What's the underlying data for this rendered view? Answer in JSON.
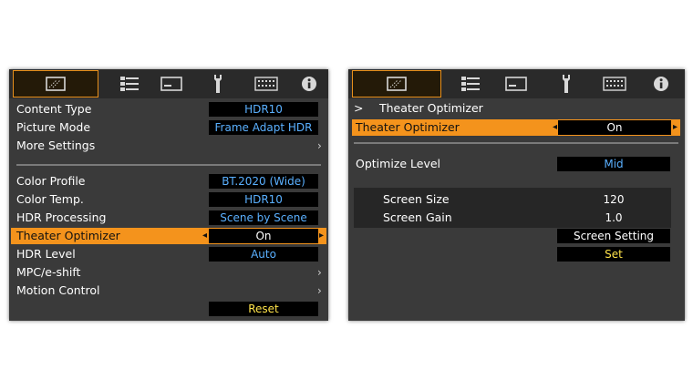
{
  "tabs": [
    "picture-icon",
    "settings-list-icon",
    "display-icon",
    "wrench-icon",
    "keyboard-icon",
    "info-icon"
  ],
  "left": {
    "rows": [
      {
        "label": "Content Type",
        "value": "HDR10"
      },
      {
        "label": "Picture Mode",
        "value": "Frame Adapt HDR"
      },
      {
        "label": "More Settings",
        "arrow": "›"
      },
      {
        "label": "Color Profile",
        "value": "BT.2020 (Wide)"
      },
      {
        "label": "Color Temp.",
        "value": "HDR10"
      },
      {
        "label": "HDR Processing",
        "value": "Scene by Scene"
      },
      {
        "label": "Theater Optimizer",
        "value": "On",
        "left_arrow": "◂",
        "right_arrow": "▸"
      },
      {
        "label": "HDR Level",
        "value": "Auto"
      },
      {
        "label": "MPC/e-shift",
        "arrow": "›"
      },
      {
        "label": "Motion Control",
        "arrow": "›"
      }
    ],
    "reset_label": "Reset"
  },
  "right": {
    "breadcrumb_arrow": ">",
    "breadcrumb": "Theater Optimizer",
    "theater_optimizer": {
      "label": "Theater Optimizer",
      "value": "On",
      "left_arrow": "◂",
      "right_arrow": "▸"
    },
    "optimize_level": {
      "label": "Optimize Level",
      "value": "Mid"
    },
    "screen_size": {
      "label": "Screen Size",
      "value": "120"
    },
    "screen_gain": {
      "label": "Screen Gain",
      "value": "1.0"
    },
    "screen_setting_label": "Screen Setting",
    "set_label": "Set"
  },
  "colors": {
    "accent": "#f4931c",
    "value_blue": "#5ab0ff",
    "value_yellow": "#ffe34a",
    "panel": "#3a3a3a"
  }
}
